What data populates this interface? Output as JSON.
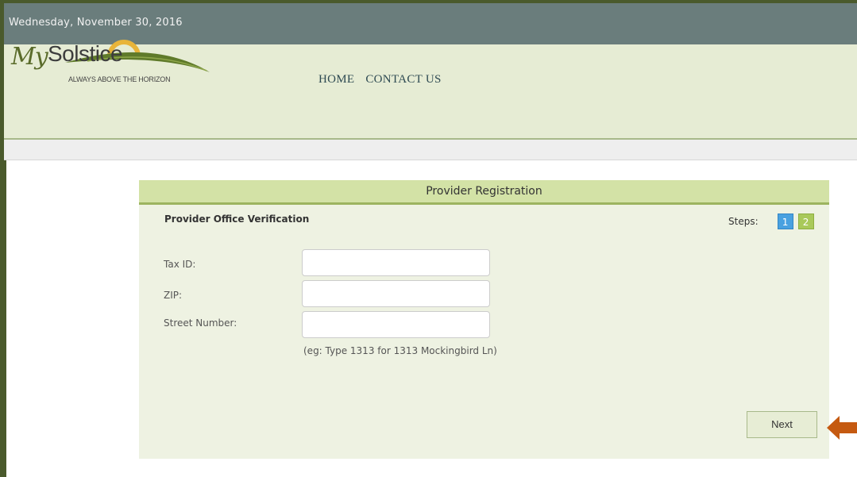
{
  "date": "Wednesday, November 30, 2016",
  "logo": {
    "my": "My",
    "brand": "Solstice",
    "tagline": "ALWAYS ABOVE THE HORIZON",
    "colors": {
      "sun": "#e8b43a",
      "hill": "#5f7a2a"
    }
  },
  "nav": {
    "items": [
      "HOME",
      "CONTACT US"
    ]
  },
  "panel": {
    "title": "Provider Registration",
    "section_title": "Provider Office Verification",
    "steps": {
      "label": "Steps:",
      "items": [
        "1",
        "2"
      ],
      "current": "1"
    }
  },
  "form": {
    "tax_id": {
      "label": "Tax ID:",
      "value": ""
    },
    "zip": {
      "label": "ZIP:",
      "value": ""
    },
    "street_number": {
      "label": "Street Number:",
      "value": ""
    },
    "hint": "(eg: Type 1313 for 1313 Mockingbird Ln)"
  },
  "next_button": {
    "label": "Next"
  },
  "colors": {
    "date_bar": "#6a7d7c",
    "header_bg": "#e6ecd4",
    "panel_header": "#d3e2a6",
    "step_current": "#49a1e0",
    "step_other": "#a9c95a",
    "arrow": "#c55a11"
  },
  "icons": {
    "callout": "arrow-left-icon"
  }
}
